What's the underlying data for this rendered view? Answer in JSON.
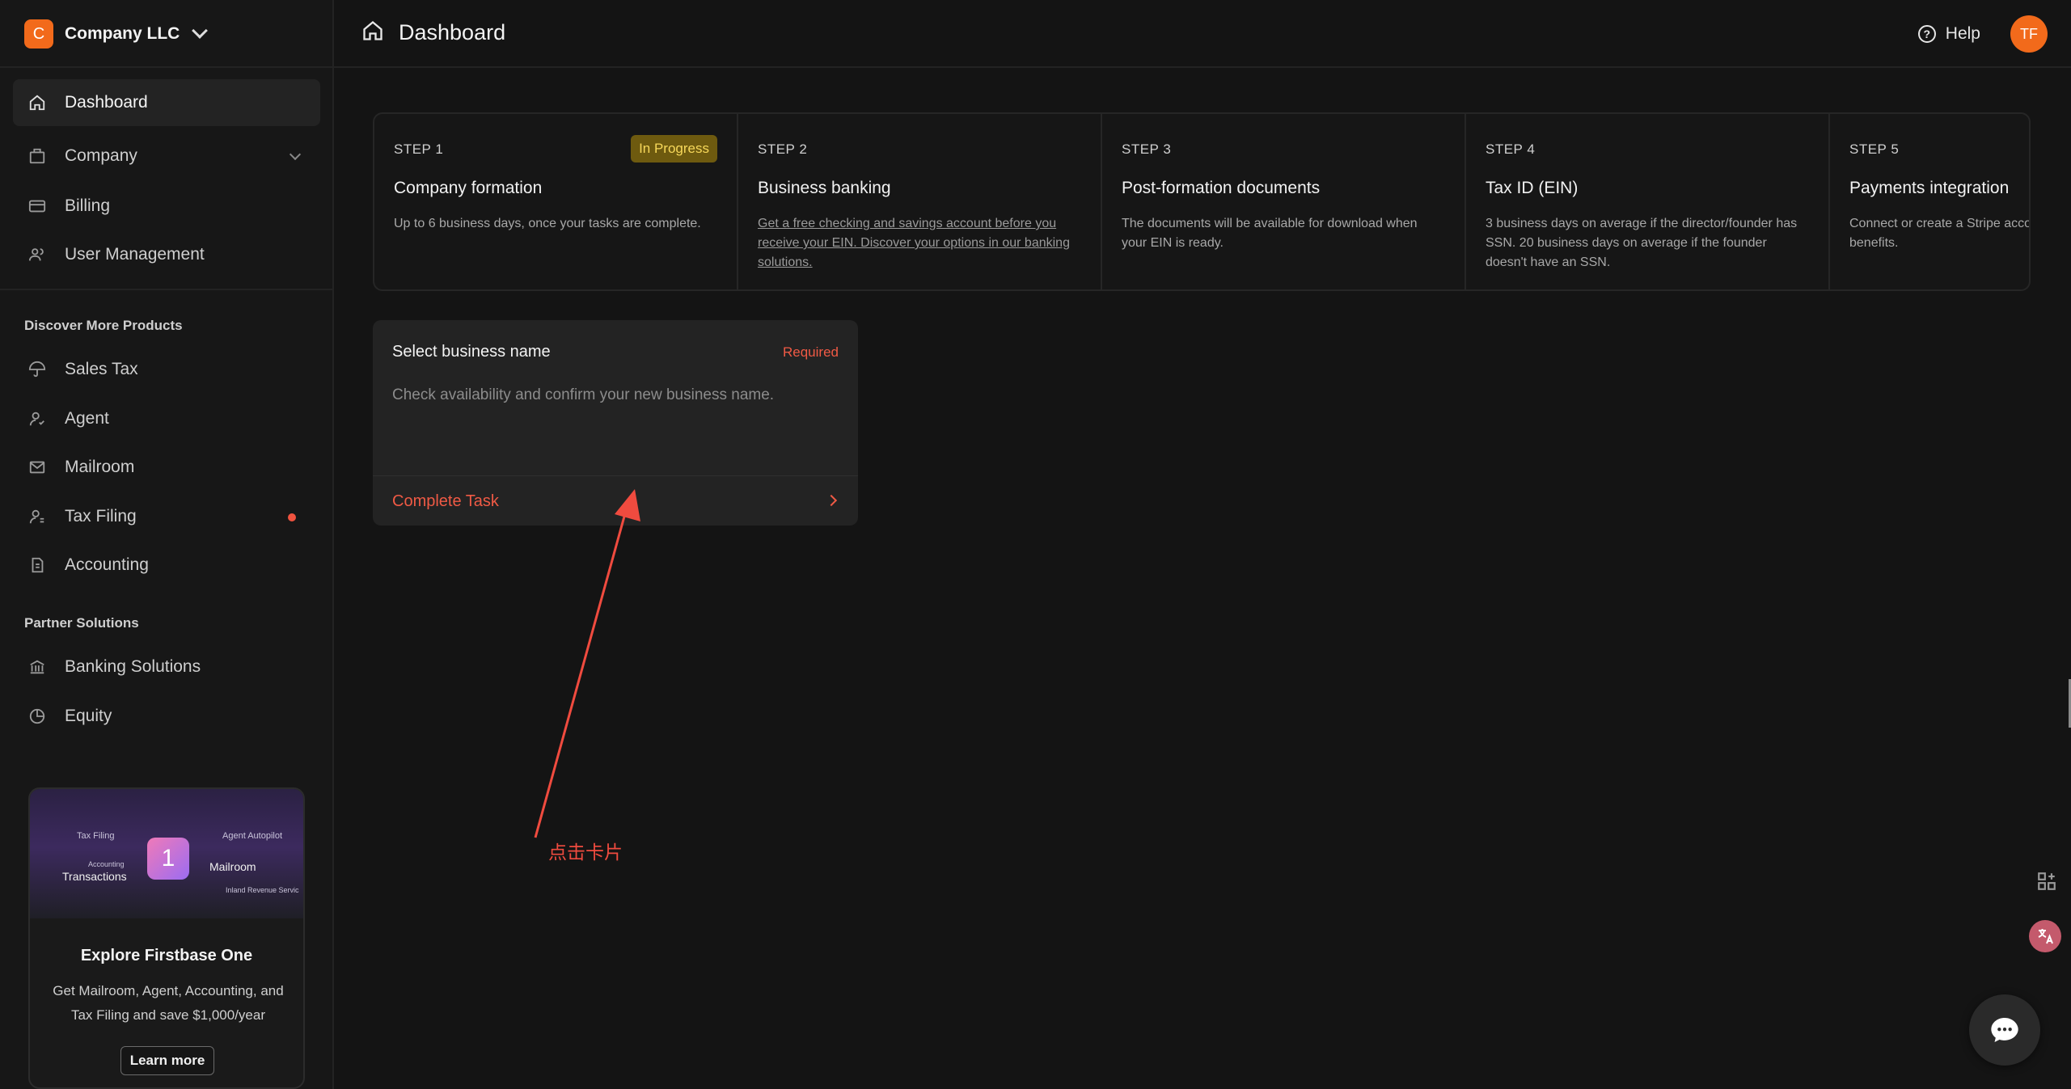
{
  "company": {
    "initial": "C",
    "name": "Company LLC"
  },
  "nav": {
    "dashboard": "Dashboard",
    "company": "Company",
    "billing": "Billing",
    "user_management": "User Management"
  },
  "discover": {
    "title": "Discover More Products",
    "items": [
      "Sales Tax",
      "Agent",
      "Mailroom",
      "Tax Filing",
      "Accounting"
    ]
  },
  "partner": {
    "title": "Partner Solutions",
    "items": [
      "Banking Solutions",
      "Equity"
    ]
  },
  "promo": {
    "image_tags": {
      "tax_filing": "Tax Filing",
      "accounting": "Accounting",
      "transactions": "Transactions",
      "agent_autopilot": "Agent Autopilot",
      "mailroom": "Mailroom",
      "inland_revenue": "Inland Revenue Servic"
    },
    "logo_glyph": "1",
    "title": "Explore Firstbase One",
    "description": "Get Mailroom, Agent, Accounting, and Tax Filing and save $1,000/year",
    "button": "Learn more"
  },
  "header": {
    "title": "Dashboard",
    "help": "Help",
    "avatar_initials": "TF"
  },
  "steps": [
    {
      "label": "STEP 1",
      "title": "Company formation",
      "badge": "In Progress",
      "description": "Up to 6 business days, once your tasks are complete.",
      "link": false
    },
    {
      "label": "STEP 2",
      "title": "Business banking",
      "badge": "",
      "description": "Get a free checking and savings account before you receive your EIN. Discover your options in our banking solutions.",
      "link": true
    },
    {
      "label": "STEP 3",
      "title": "Post-formation documents",
      "badge": "",
      "description": "The documents will be available for download when your EIN is ready.",
      "link": false
    },
    {
      "label": "STEP 4",
      "title": "Tax ID (EIN)",
      "badge": "",
      "description": "3 business days on average if the director/founder has SSN. 20 business days on average if the founder doesn't have an SSN.",
      "link": false
    },
    {
      "label": "STEP 5",
      "title": "Payments integration",
      "badge": "",
      "description": "Connect or create a Stripe account to get exclusive benefits.",
      "link": false
    }
  ],
  "task": {
    "title": "Select business name",
    "required": "Required",
    "description": "Check availability and confirm your new business name.",
    "action": "Complete Task"
  },
  "annotation": {
    "label": "点击卡片"
  },
  "colors": {
    "accent_orange": "#f26a1b",
    "required_red": "#f05a45",
    "badge_bg": "#6e5a0f",
    "badge_text": "#f7d85a",
    "annotation_red": "#f04b3f"
  }
}
